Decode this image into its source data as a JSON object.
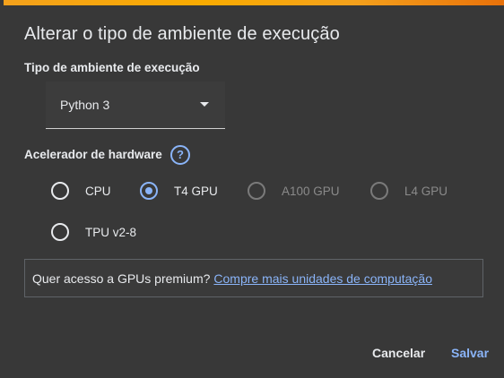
{
  "dialog": {
    "title": "Alterar o tipo de ambiente de execução",
    "accent_color": "#f9ab00"
  },
  "runtime": {
    "label": "Tipo de ambiente de execução",
    "selected": "Python 3"
  },
  "accelerator": {
    "label": "Acelerador de hardware",
    "help_icon": "?",
    "options": [
      {
        "label": "CPU",
        "checked": false,
        "disabled": false
      },
      {
        "label": "T4 GPU",
        "checked": true,
        "disabled": false
      },
      {
        "label": "A100 GPU",
        "checked": false,
        "disabled": true
      },
      {
        "label": "L4 GPU",
        "checked": false,
        "disabled": true
      },
      {
        "label": "TPU v2-8",
        "checked": false,
        "disabled": false
      }
    ]
  },
  "promo": {
    "text": "Quer acesso a GPUs premium?",
    "link": "Compre mais unidades de computação"
  },
  "actions": {
    "cancel_label": "Cancelar",
    "save_label": "Salvar"
  }
}
